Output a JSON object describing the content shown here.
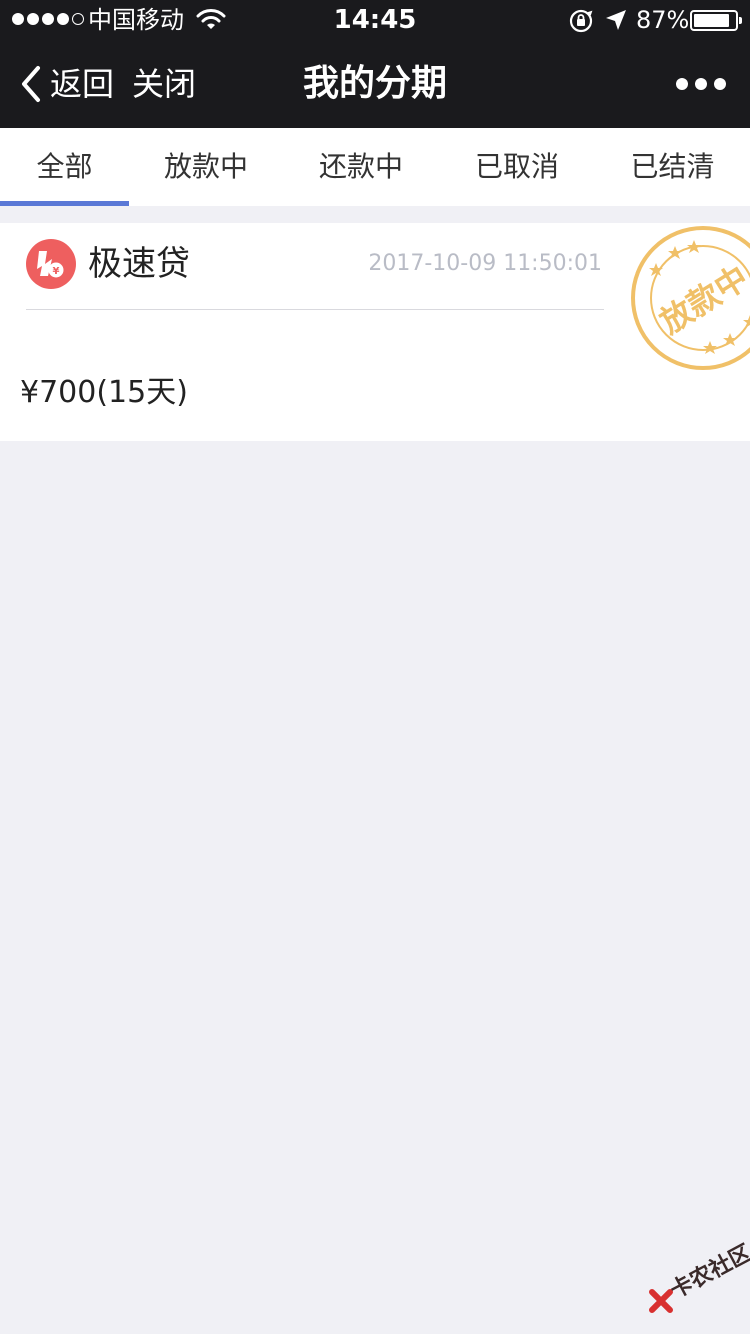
{
  "status_bar": {
    "carrier": "中国移动",
    "time": "14:45",
    "battery_percent": "87%",
    "battery_level": 0.87,
    "signal_bars": 4,
    "signal_total": 5
  },
  "nav": {
    "back_label": "返回",
    "close_label": "关闭",
    "title": "我的分期"
  },
  "tabs": [
    {
      "label": "全部",
      "active": true
    },
    {
      "label": "放款中",
      "active": false
    },
    {
      "label": "还款中",
      "active": false
    },
    {
      "label": "已取消",
      "active": false
    },
    {
      "label": "已结清",
      "active": false
    }
  ],
  "loans": [
    {
      "product_name": "极速贷",
      "timestamp": "2017-10-09 11:50:01",
      "amount": "¥700(15天)",
      "stamp_text": "放款中"
    }
  ],
  "watermark": {
    "text": "卡农社区"
  },
  "colors": {
    "header_bg": "#1a1a1d",
    "tab_indicator": "#5a78d6",
    "logo_red": "#ee5f5f",
    "stamp_orange": "#f0c068",
    "page_bg": "#f0f0f5"
  }
}
